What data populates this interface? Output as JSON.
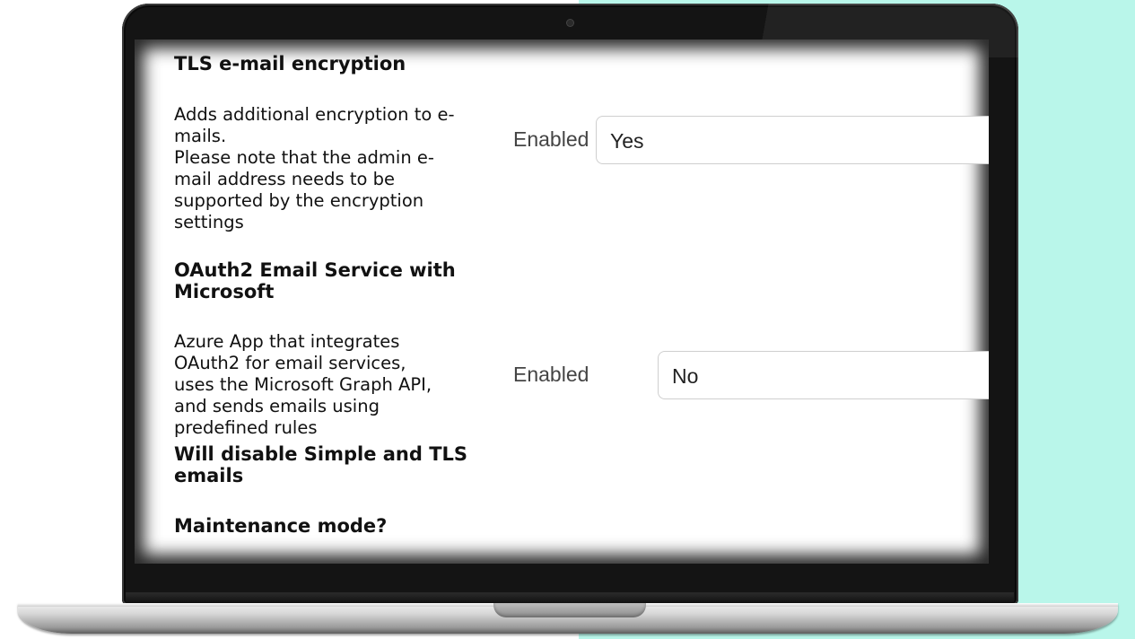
{
  "tls": {
    "heading": "TLS e-mail encryption",
    "description": "Adds additional encryption to e-\nmails.\nPlease note that the admin e-\nmail address needs to be\nsupported by the encryption\nsettings",
    "enabled_label": "Enabled",
    "enabled_value": "Yes"
  },
  "oauth": {
    "heading": "OAuth2 Email Service with\nMicrosoft",
    "description": "Azure App that integrates\nOAuth2 for email services,\nuses the Microsoft Graph API,\nand sends emails using\npredefined rules",
    "warning": "Will disable Simple and TLS\nemails",
    "enabled_label": "Enabled",
    "enabled_value": "No"
  },
  "maintenance": {
    "heading": "Maintenance mode?"
  },
  "colors": {
    "background_accent": "#b9f6ea"
  }
}
